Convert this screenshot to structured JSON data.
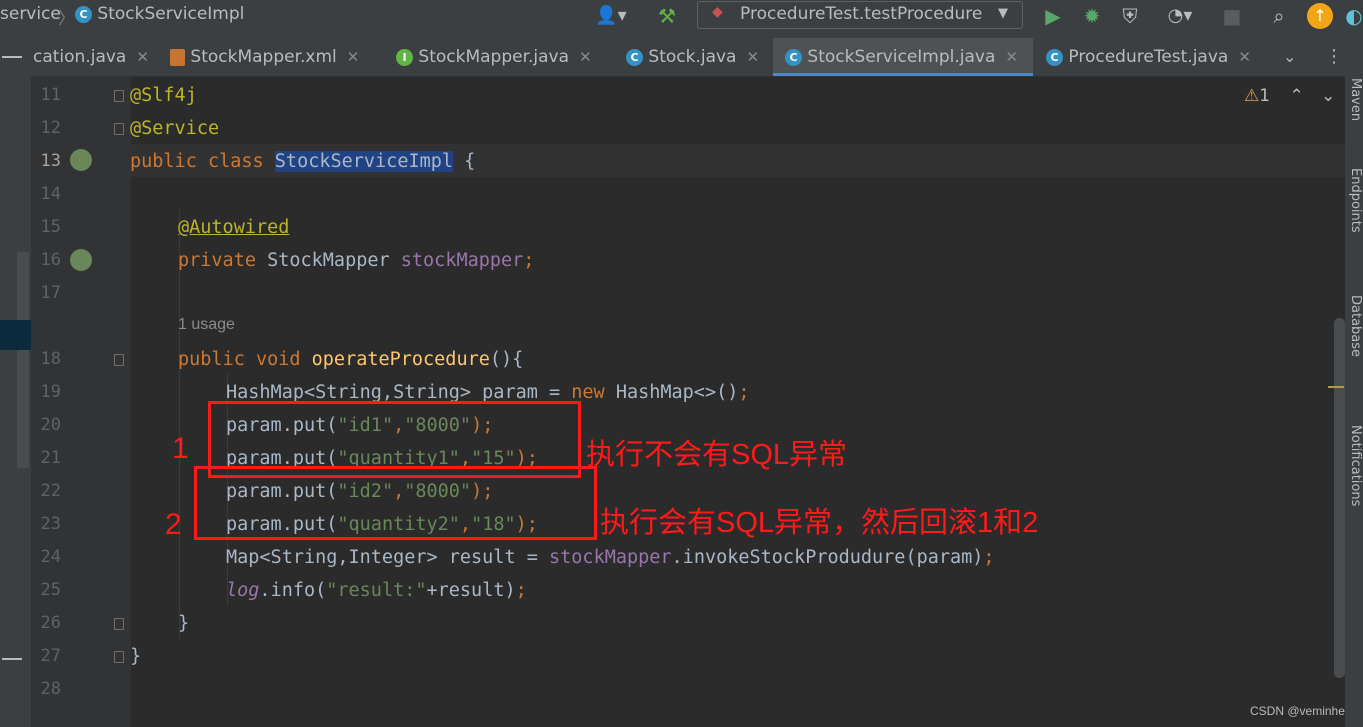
{
  "breadcrumb": {
    "part1": "service",
    "part2": "StockServiceImpl"
  },
  "run_config": "ProcedureTest.testProcedure",
  "tabs": [
    {
      "label": "cation.java",
      "active": false
    },
    {
      "label": "StockMapper.xml",
      "active": false
    },
    {
      "label": "StockMapper.java",
      "active": false
    },
    {
      "label": "Stock.java",
      "active": false
    },
    {
      "label": "StockServiceImpl.java",
      "active": true
    },
    {
      "label": "ProcedureTest.java",
      "active": false
    }
  ],
  "inspection": {
    "warning_count": "1"
  },
  "line_numbers": [
    "11",
    "12",
    "13",
    "14",
    "15",
    "16",
    "17",
    "18",
    "19",
    "20",
    "21",
    "22",
    "23",
    "24",
    "25",
    "26",
    "27",
    "28"
  ],
  "usage_hint": "1 usage",
  "code": {
    "l11": "@Slf4j",
    "l12": "@Service",
    "l13_kw": "public class ",
    "l13_cls": "StockServiceImpl",
    "l13_end": " {",
    "l15": "@Autowired",
    "l16_kw": "private ",
    "l16_type": "StockMapper ",
    "l16_field": "stockMapper",
    "l16_end": ";",
    "l18_kw": "public void ",
    "l18_mth": "operateProcedure",
    "l18_end": "(){",
    "l19_a": "HashMap<String,String> param = ",
    "l19_kw": "new ",
    "l19_b": "HashMap<>()",
    "l19_end": ";",
    "l20_a": "param.put(",
    "l20_s1": "\"id1\"",
    "l20_c": ",",
    "l20_s2": "\"8000\"",
    "l20_end": ");",
    "l21_a": "param.put(",
    "l21_s1": "\"quantity1\"",
    "l21_c": ",",
    "l21_s2": "\"15\"",
    "l21_end": ");",
    "l22_a": "param.put(",
    "l22_s1": "\"id2\"",
    "l22_c": ",",
    "l22_s2": "\"8000\"",
    "l22_end": ");",
    "l23_a": "param.put(",
    "l23_s1": "\"quantity2\"",
    "l23_c": ",",
    "l23_s2": "\"18\"",
    "l23_end": ");",
    "l24_a": "Map<String,Integer> result = ",
    "l24_fld": "stockMapper",
    "l24_b": ".invokeStockProdudure(param)",
    "l24_end": ";",
    "l25_log": "log",
    "l25_a": ".info(",
    "l25_str": "\"result:\"",
    "l25_b": "+result)",
    "l25_end": ";",
    "l26": "}",
    "l27": "}"
  },
  "annotations": {
    "num1": "1",
    "num2": "2",
    "note1": "执行不会有SQL异常",
    "note2": "执行会有SQL异常，然后回滚1和2"
  },
  "right_tool_windows": [
    "Maven",
    "Endpoints",
    "Database",
    "Notifications"
  ],
  "watermark": "CSDN @veminhe",
  "colors": {
    "accent": "#4a88c7",
    "annotation_red": "#ff1a1a",
    "keyword": "#cc7832",
    "string": "#6a8759",
    "field": "#9876aa",
    "method": "#ffc66d",
    "annotation": "#bbb529"
  }
}
